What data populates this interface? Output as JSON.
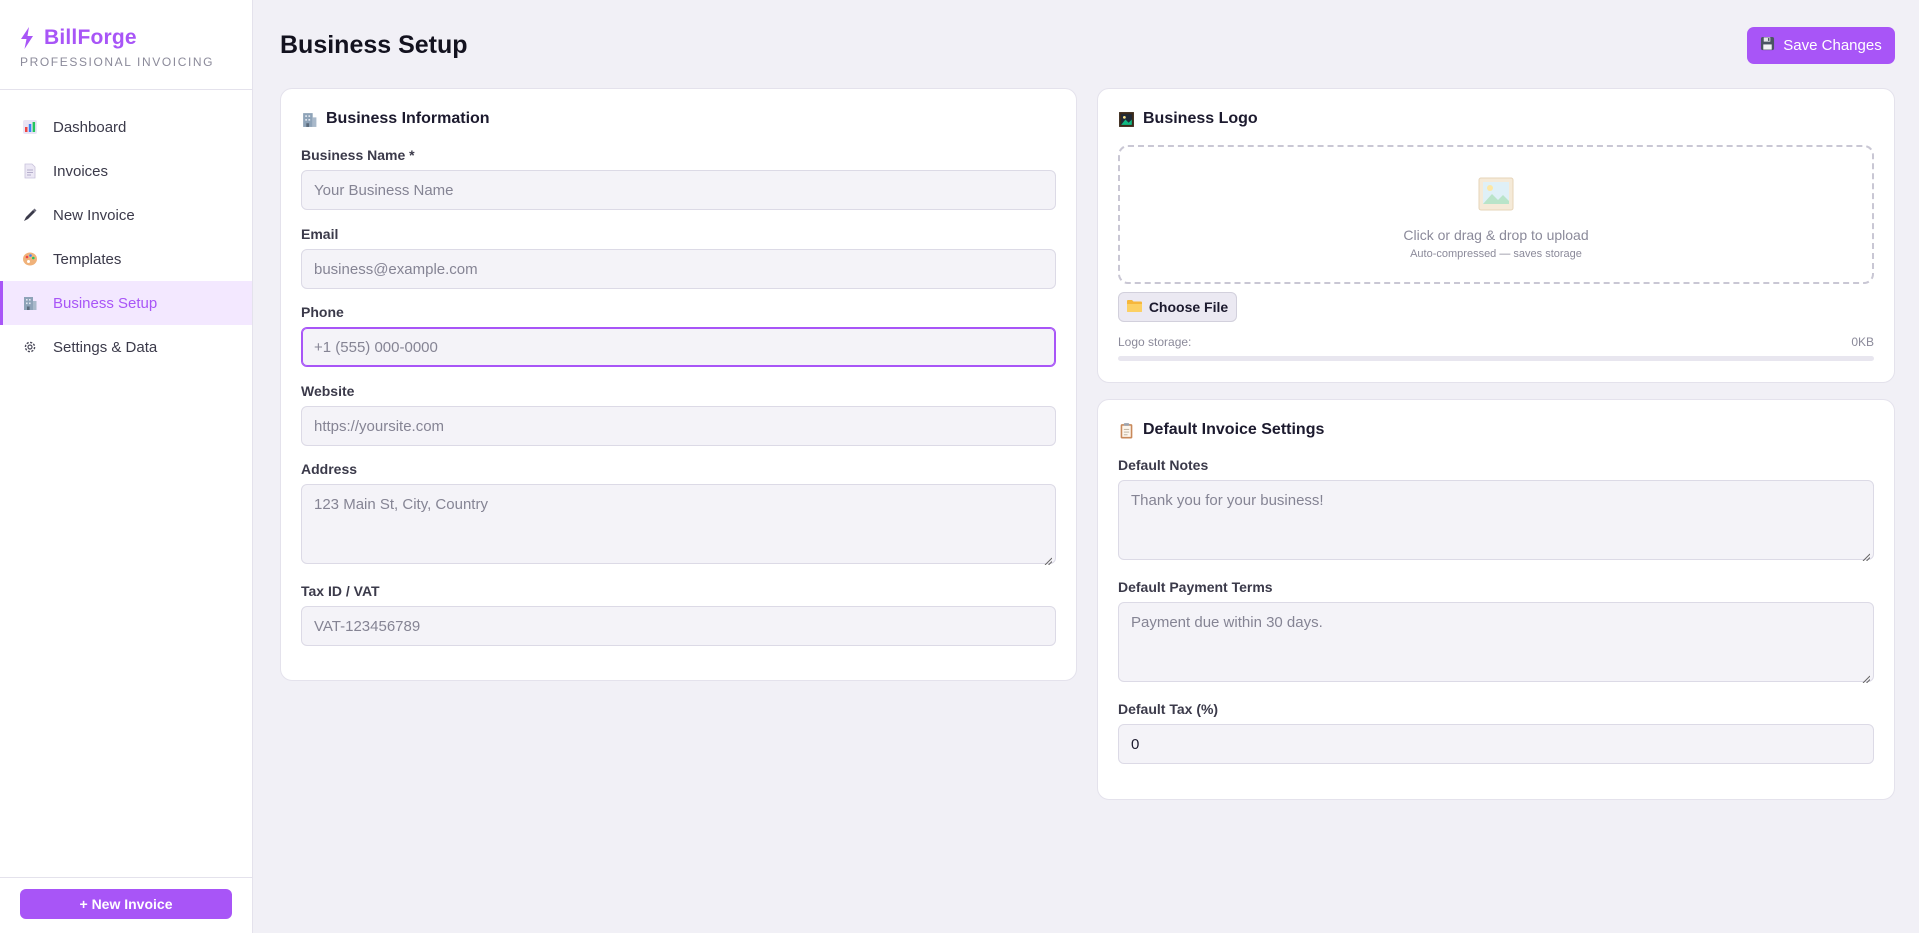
{
  "brand": {
    "name": "BillForge",
    "tagline": "PROFESSIONAL INVOICING"
  },
  "nav": {
    "items": [
      {
        "label": "Dashboard",
        "icon": "bar-chart-icon",
        "active": false
      },
      {
        "label": "Invoices",
        "icon": "document-icon",
        "active": false
      },
      {
        "label": "New Invoice",
        "icon": "pen-icon",
        "active": false
      },
      {
        "label": "Templates",
        "icon": "palette-icon",
        "active": false
      },
      {
        "label": "Business Setup",
        "icon": "building-icon",
        "active": true
      },
      {
        "label": "Settings & Data",
        "icon": "gear-icon",
        "active": false
      }
    ]
  },
  "sidebar_footer": {
    "new_invoice_label": "+ New Invoice"
  },
  "header": {
    "title": "Business Setup",
    "save_label": "Save Changes"
  },
  "business_info": {
    "title": "Business Information",
    "fields": {
      "name": {
        "label": "Business Name *",
        "placeholder": "Your Business Name",
        "value": ""
      },
      "email": {
        "label": "Email",
        "placeholder": "business@example.com",
        "value": ""
      },
      "phone": {
        "label": "Phone",
        "placeholder": "+1 (555) 000-0000",
        "value": ""
      },
      "website": {
        "label": "Website",
        "placeholder": "https://yoursite.com",
        "value": ""
      },
      "address": {
        "label": "Address",
        "placeholder": "123 Main St, City, Country",
        "value": ""
      },
      "tax_id": {
        "label": "Tax ID / VAT",
        "placeholder": "VAT-123456789",
        "value": ""
      }
    }
  },
  "business_logo": {
    "title": "Business Logo",
    "dropzone_text": "Click or drag & drop to upload",
    "dropzone_subtext": "Auto-compressed — saves storage",
    "choose_label": "Choose File",
    "storage_label": "Logo storage:",
    "storage_value": "0KB",
    "storage_fraction": 0
  },
  "invoice_defaults": {
    "title": "Default Invoice Settings",
    "fields": {
      "notes": {
        "label": "Default Notes",
        "placeholder": "Thank you for your business!",
        "value": ""
      },
      "terms": {
        "label": "Default Payment Terms",
        "placeholder": "Payment due within 30 days.",
        "value": ""
      },
      "tax": {
        "label": "Default Tax (%)",
        "value": "0"
      }
    }
  },
  "colors": {
    "accent": "#a855f7",
    "accent_light": "#f3e8ff",
    "background": "#f1f0f6"
  }
}
